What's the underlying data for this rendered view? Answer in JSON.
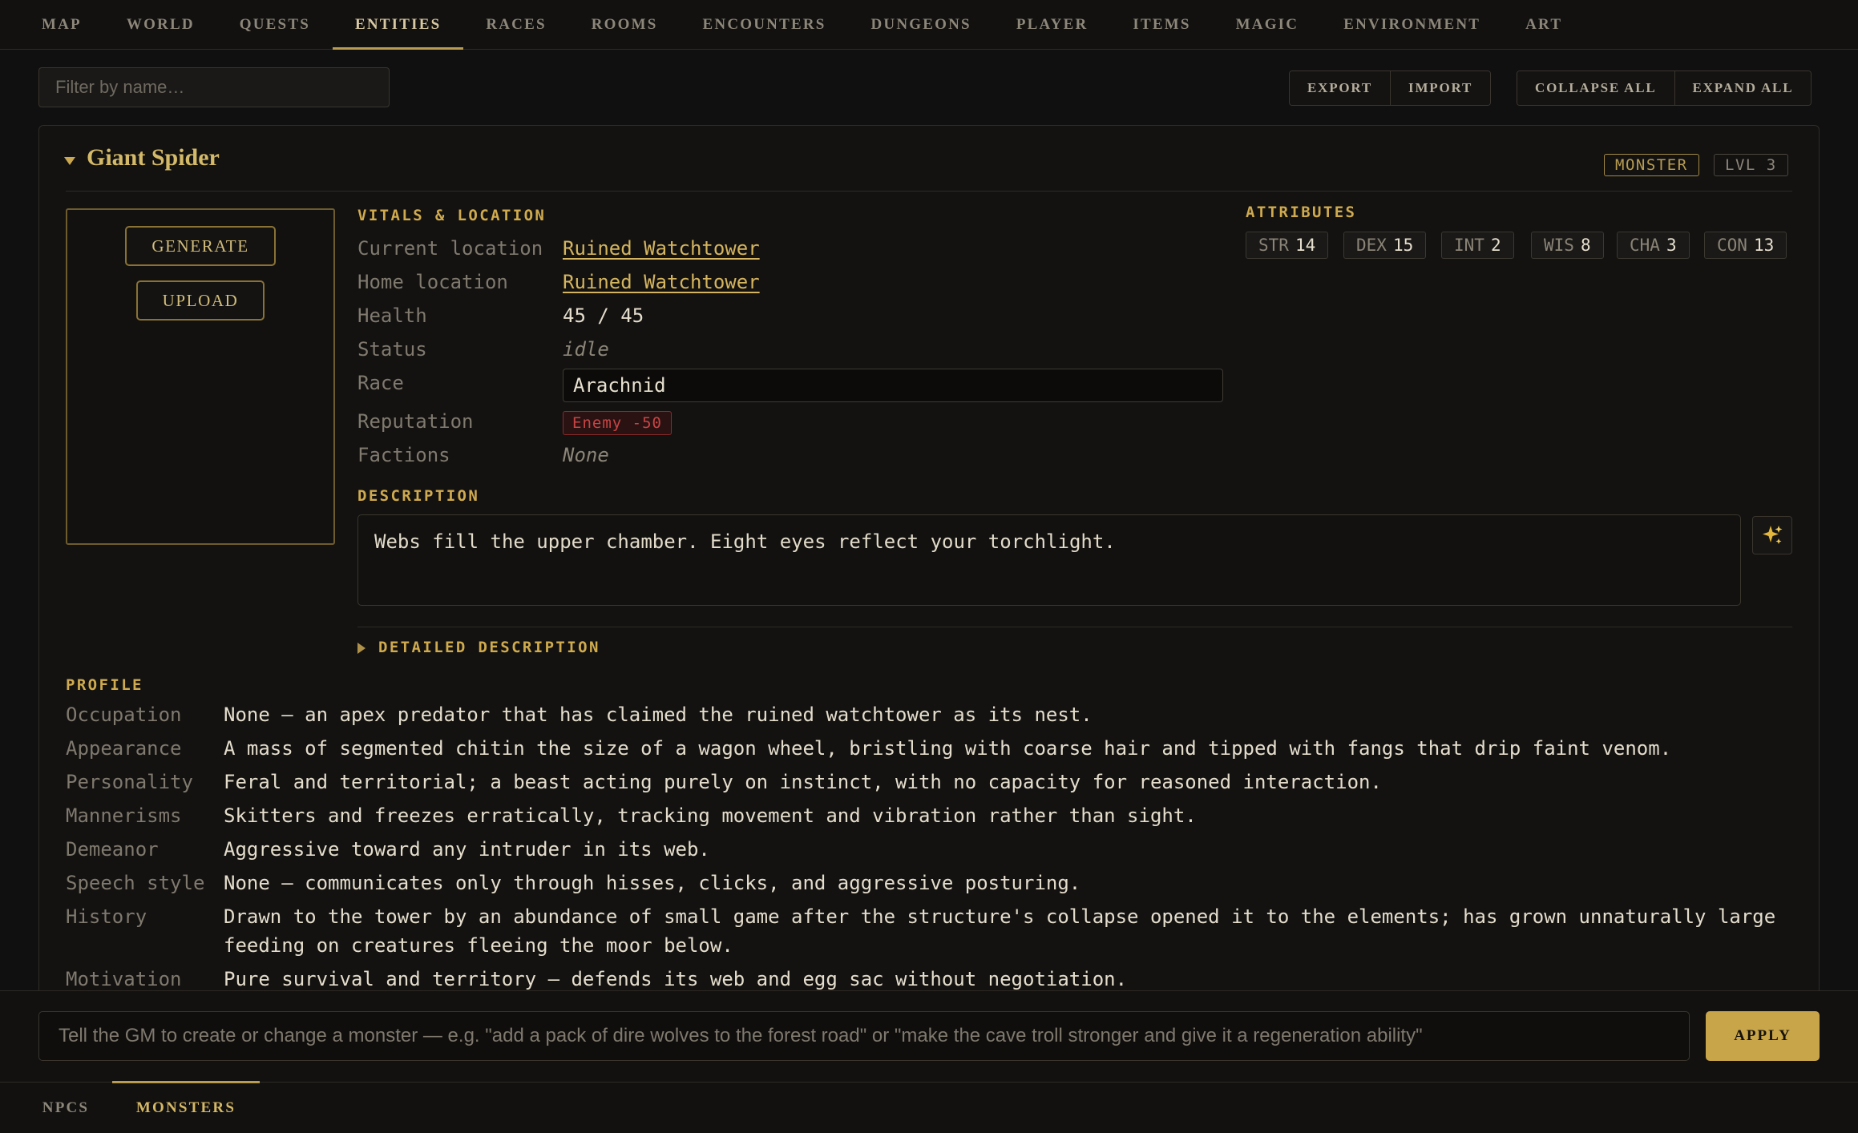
{
  "nav": {
    "tabs": [
      {
        "label": "MAP"
      },
      {
        "label": "WORLD"
      },
      {
        "label": "QUESTS"
      },
      {
        "label": "ENTITIES"
      },
      {
        "label": "RACES"
      },
      {
        "label": "ROOMS"
      },
      {
        "label": "ENCOUNTERS"
      },
      {
        "label": "DUNGEONS"
      },
      {
        "label": "PLAYER"
      },
      {
        "label": "ITEMS"
      },
      {
        "label": "MAGIC"
      },
      {
        "label": "ENVIRONMENT"
      },
      {
        "label": "ART"
      }
    ],
    "active": "ENTITIES"
  },
  "toolbar": {
    "filter_placeholder": "Filter by name…",
    "export_label": "EXPORT",
    "import_label": "IMPORT",
    "collapse_label": "COLLAPSE ALL",
    "expand_label": "EXPAND ALL"
  },
  "entity": {
    "name": "Giant Spider",
    "type_tag": "MONSTER",
    "level_tag": "LVL 3",
    "generate_label": "GENERATE",
    "upload_label": "UPLOAD",
    "vitals_heading": "VITALS & LOCATION",
    "vitals": {
      "current_location_label": "Current location",
      "current_location": "Ruined Watchtower",
      "home_location_label": "Home location",
      "home_location": "Ruined Watchtower",
      "health_label": "Health",
      "health": "45 / 45",
      "status_label": "Status",
      "status": "idle",
      "race_label": "Race",
      "race": "Arachnid",
      "reputation_label": "Reputation",
      "reputation": "Enemy -50",
      "factions_label": "Factions",
      "factions": "None"
    },
    "attributes_heading": "ATTRIBUTES",
    "attributes": [
      {
        "key": "STR",
        "value": "14"
      },
      {
        "key": "DEX",
        "value": "15"
      },
      {
        "key": "INT",
        "value": "2"
      },
      {
        "key": "WIS",
        "value": "8"
      },
      {
        "key": "CHA",
        "value": "3"
      },
      {
        "key": "CON",
        "value": "13"
      }
    ],
    "description_heading": "DESCRIPTION",
    "description": "Webs fill the upper chamber. Eight eyes reflect your torchlight.",
    "detailed_heading": "DETAILED DESCRIPTION",
    "profile_heading": "PROFILE",
    "profile": [
      {
        "label": "Occupation",
        "value": "None — an apex predator that has claimed the ruined watchtower as its nest."
      },
      {
        "label": "Appearance",
        "value": "A mass of segmented chitin the size of a wagon wheel, bristling with coarse hair and tipped with fangs that drip faint venom."
      },
      {
        "label": "Personality",
        "value": "Feral and territorial; a beast acting purely on instinct, with no capacity for reasoned interaction."
      },
      {
        "label": "Mannerisms",
        "value": "Skitters and freezes erratically, tracking movement and vibration rather than sight."
      },
      {
        "label": "Demeanor",
        "value": "Aggressive toward any intruder in its web."
      },
      {
        "label": "Speech style",
        "value": "None — communicates only through hisses, clicks, and aggressive posturing."
      },
      {
        "label": "History",
        "value": "Drawn to the tower by an abundance of small game after the structure's collapse opened it to the elements; has grown unnaturally large feeding on creatures fleeing the moor below."
      },
      {
        "label": "Motivation",
        "value": "Pure survival and territory — defends its web and egg sac without negotiation."
      }
    ]
  },
  "gm": {
    "placeholder": "Tell the GM to create or change a monster — e.g. \"add a pack of dire wolves to the forest road\" or \"make the cave troll stronger and give it a regeneration ability\"",
    "apply_label": "APPLY"
  },
  "subtabs": [
    {
      "label": "NPCS"
    },
    {
      "label": "MONSTERS"
    }
  ],
  "colors": {
    "accent": "#c9a54a",
    "background": "#111010",
    "danger": "#c74545"
  },
  "icons": {
    "magic": "sparkles-icon"
  }
}
